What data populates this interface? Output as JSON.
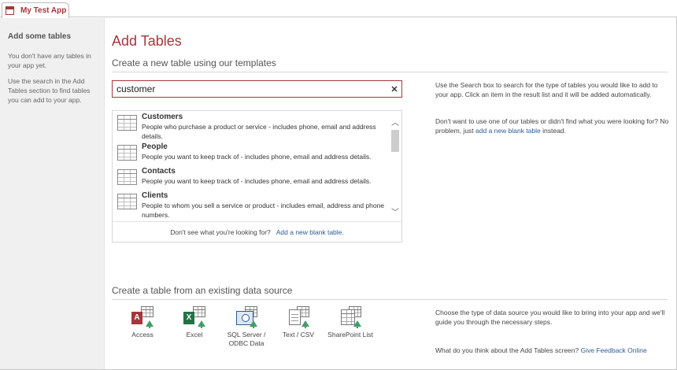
{
  "tab": {
    "title": "My Test App"
  },
  "left_pane": {
    "heading": "Add some tables",
    "para1": "You don't have any tables in your app yet.",
    "para2": "Use the search in the Add Tables section to find tables you can add to your app."
  },
  "main": {
    "title": "Add Tables",
    "template_heading": "Create a new table using our templates",
    "search": {
      "value": "customer",
      "clear_icon": "close-icon"
    },
    "results": [
      {
        "name": "Customers",
        "desc": "People who purchase a product or service - includes phone, email and address details."
      },
      {
        "name": "People",
        "desc": "People you want to keep track of - includes phone, email and address details."
      },
      {
        "name": "Contacts",
        "desc": "People you want to keep track of - includes phone, email and address details."
      },
      {
        "name": "Clients",
        "desc": "People to whom you sell a service or product - includes email, address and phone numbers."
      }
    ],
    "footer_text": "Don't see what you're looking for?",
    "footer_link": "Add a new blank table.",
    "help1": "Use the Search box to search for the type of tables you would like to add to your app. Click an item in the result list and it will be added automatically.",
    "help2_text": "Don't want to use one of our tables or didn't find what you were looking for? No problem, just",
    "help2_link": "add a new blank table",
    "help2_end": "instead.",
    "existing_heading": "Create a table from an existing data source",
    "sources": [
      {
        "label": "Access",
        "icon": "access-icon"
      },
      {
        "label": "Excel",
        "icon": "excel-icon"
      },
      {
        "label": "SQL Server / ODBC Data",
        "icon": "sql-server-icon"
      },
      {
        "label": "Text / CSV",
        "icon": "text-csv-icon"
      },
      {
        "label": "SharePoint List",
        "icon": "sharepoint-list-icon"
      }
    ],
    "help3": "Choose the type of data source you would like to bring into your app and we'll guide you through the necessary steps.",
    "feedback_text": "What do you think about the Add Tables screen?",
    "feedback_link": "Give Feedback Online"
  },
  "colors": {
    "accent": "#a4373a",
    "link": "#2e5c94",
    "left_bg": "#f0f0f0"
  }
}
